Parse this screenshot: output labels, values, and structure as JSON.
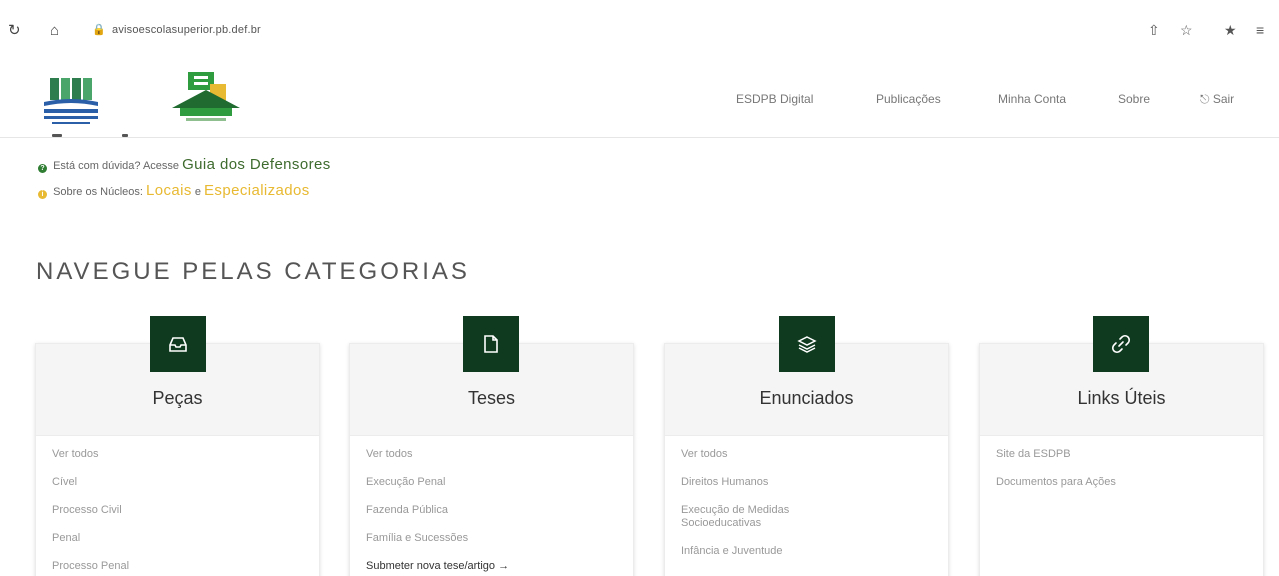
{
  "browser": {
    "url": "avisoescolasuperior.pb.def.br",
    "icons": [
      "reload-icon",
      "home-icon",
      "lock-icon",
      "share-icon",
      "star-icon",
      "extensions-icon",
      "menu-icon"
    ]
  },
  "header": {
    "nav": [
      "ESDPB Digital",
      "Publicações",
      "Minha Conta",
      "Sobre",
      "Sair"
    ]
  },
  "info": {
    "line1_prefix": "Está com dúvida? Acesse",
    "line1_link": "Guia dos Defensores",
    "line2_prefix": "Sobre os Núcleos:",
    "line2_link1": "Locais",
    "line2_sep": "e",
    "line2_link2": "Especializados"
  },
  "section_title": "NAVEGUE PELAS CATEGORIAS",
  "cards": [
    {
      "title": "Peças",
      "icon": "inbox-icon",
      "items": [
        "Ver todos",
        "Cível",
        "Processo Civil",
        "Penal",
        "Processo Penal"
      ]
    },
    {
      "title": "Teses",
      "icon": "document-icon",
      "items": [
        "Ver todos",
        "Execução Penal",
        "Fazenda Pública",
        "Família e Sucessões",
        "Submeter nova tese/artigo →"
      ]
    },
    {
      "title": "Enunciados",
      "icon": "stack-icon",
      "items": [
        "Ver todos",
        "Direitos Humanos",
        "Execução de Medidas",
        "Socioeducativas",
        "Infância e Juventude"
      ]
    },
    {
      "title": "Links Úteis",
      "icon": "link-icon",
      "items": [
        "Site da ESDPB",
        "Documentos para Ações"
      ]
    }
  ],
  "colors": {
    "brand_dark_green": "#0f3a1f",
    "link_green": "#3e6b2e",
    "link_yellow": "#e8b932",
    "info_green": "#2e7d32",
    "info_yellow": "#e8b932"
  }
}
